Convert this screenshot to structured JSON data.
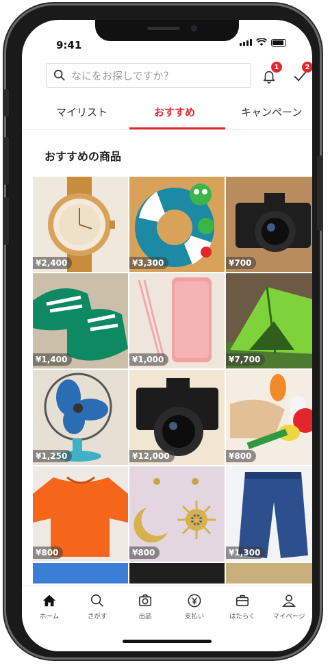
{
  "status_bar": {
    "time": "9:41"
  },
  "search": {
    "placeholder": "なにをお探しですか？"
  },
  "notifications": {
    "bell_badge": "1",
    "todo_badge": "2"
  },
  "tabs": [
    {
      "label": "マイリスト",
      "active": false
    },
    {
      "label": "おすすめ",
      "active": true
    },
    {
      "label": "キャンペーン",
      "active": false
    }
  ],
  "section": {
    "title": "おすすめの商品"
  },
  "items": [
    {
      "name": "watch",
      "price": "¥2,400"
    },
    {
      "name": "swim-ring",
      "price": "¥3,300"
    },
    {
      "name": "camera",
      "price": "¥700"
    },
    {
      "name": "sneakers",
      "price": "¥1,400"
    },
    {
      "name": "phone-case",
      "price": "¥1,000"
    },
    {
      "name": "tent",
      "price": "¥7,700"
    },
    {
      "name": "electric-fan",
      "price": "¥1,250"
    },
    {
      "name": "film-camera",
      "price": "¥12,000"
    },
    {
      "name": "toy-food",
      "price": "¥800"
    },
    {
      "name": "orange-shirt",
      "price": "¥800"
    },
    {
      "name": "earrings",
      "price": "¥800"
    },
    {
      "name": "jeans",
      "price": "¥1,300"
    }
  ],
  "tabbar": [
    {
      "label": "ホーム",
      "icon": "home-icon",
      "active": true
    },
    {
      "label": "さがす",
      "icon": "search-icon",
      "active": false
    },
    {
      "label": "出品",
      "icon": "camera-icon",
      "active": false
    },
    {
      "label": "支払い",
      "icon": "yen-icon",
      "active": false
    },
    {
      "label": "はたらく",
      "icon": "briefcase-icon",
      "active": false
    },
    {
      "label": "マイページ",
      "icon": "person-icon",
      "active": false
    }
  ],
  "colors": {
    "accent": "#e3262e",
    "text": "#222222"
  }
}
